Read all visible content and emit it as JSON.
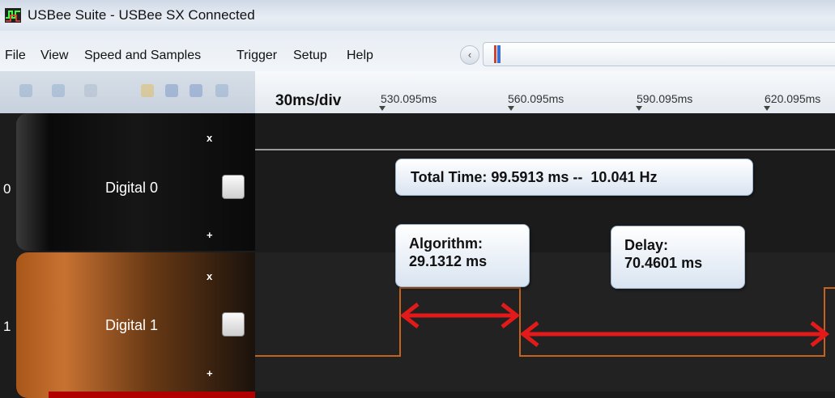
{
  "window": {
    "title": "USBee Suite - USBee SX Connected"
  },
  "menu": [
    "File",
    "View",
    "Speed and Samples",
    "Trigger",
    "Setup",
    "Help"
  ],
  "ruler": {
    "scale": "30ms/div",
    "ticks": [
      "530.095ms",
      "560.095ms",
      "590.095ms",
      "620.095ms"
    ]
  },
  "channels": [
    {
      "number": "0",
      "name": "Digital 0",
      "minus": "x",
      "plus": "+"
    },
    {
      "number": "1",
      "name": "Digital 1",
      "minus": "x",
      "plus": "+"
    }
  ],
  "callouts": {
    "total": "Total Time: 99.5913 ms --  10.041 Hz",
    "algorithm_line1": "Algorithm:",
    "algorithm_line2": "29.1312 ms",
    "delay_line1": "Delay:",
    "delay_line2": "70.4601 ms"
  },
  "colors": {
    "trace": "#c4621e",
    "arrow": "#e41a1a",
    "channel1": "#c87232"
  }
}
